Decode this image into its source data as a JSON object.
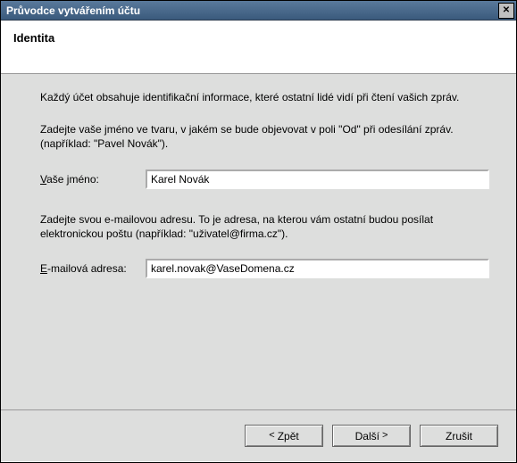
{
  "window": {
    "title": "Průvodce vytvářením účtu"
  },
  "header": {
    "title": "Identita"
  },
  "content": {
    "intro": "Každý účet obsahuje identifikační informace, které ostatní lidé vidí při čtení vašich zpráv.",
    "name_help": "Zadejte vaše jméno ve tvaru, v jakém se bude objevovat v poli \"Od\" při odesílání zpráv. (například: \"Pavel Novák\").",
    "name_label_pre": "V",
    "name_label_post": "aše jméno:",
    "name_value": "Karel Novák",
    "email_help": "Zadejte svou e-mailovou adresu. To je adresa, na kterou vám ostatní budou posílat elektronickou poštu (například: \"uživatel@firma.cz\").",
    "email_label_pre": "E",
    "email_label_post": "-mailová adresa:",
    "email_value": "karel.novak@VaseDomena.cz"
  },
  "buttons": {
    "back": "Zpět",
    "next": "Další",
    "cancel": "Zrušit"
  }
}
